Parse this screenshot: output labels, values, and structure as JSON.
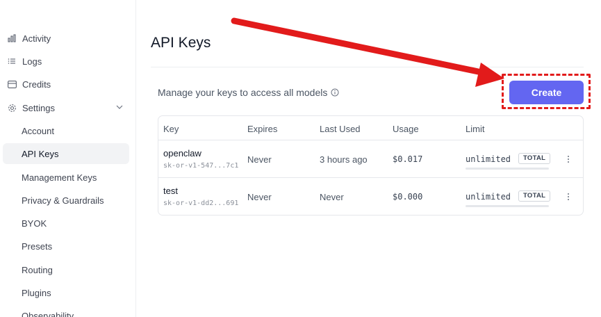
{
  "sidebar": {
    "items": [
      {
        "label": "Activity",
        "icon": "bar-chart-icon"
      },
      {
        "label": "Logs",
        "icon": "list-icon"
      },
      {
        "label": "Credits",
        "icon": "credit-card-icon"
      },
      {
        "label": "Settings",
        "icon": "gear-icon",
        "expanded": true
      }
    ],
    "sub_items": [
      {
        "label": "Account"
      },
      {
        "label": "API Keys",
        "active": true
      },
      {
        "label": "Management Keys"
      },
      {
        "label": "Privacy & Guardrails"
      },
      {
        "label": "BYOK"
      },
      {
        "label": "Presets"
      },
      {
        "label": "Routing"
      },
      {
        "label": "Plugins"
      },
      {
        "label": "Observability"
      }
    ]
  },
  "page": {
    "title": "API Keys",
    "subtitle": "Manage your keys to access all models",
    "create_label": "Create"
  },
  "table": {
    "headers": {
      "key": "Key",
      "expires": "Expires",
      "last_used": "Last Used",
      "usage": "Usage",
      "limit": "Limit"
    },
    "rows": [
      {
        "name": "openclaw",
        "masked": "sk-or-v1-547...7c1",
        "expires": "Never",
        "last_used": "3 hours ago",
        "usage": "$0.017",
        "limit": "unlimited",
        "limit_type": "TOTAL"
      },
      {
        "name": "test",
        "masked": "sk-or-v1-dd2...691",
        "expires": "Never",
        "last_used": "Never",
        "usage": "$0.000",
        "limit": "unlimited",
        "limit_type": "TOTAL"
      }
    ]
  },
  "colors": {
    "accent": "#6366f1",
    "annotation": "#e21b1b"
  }
}
